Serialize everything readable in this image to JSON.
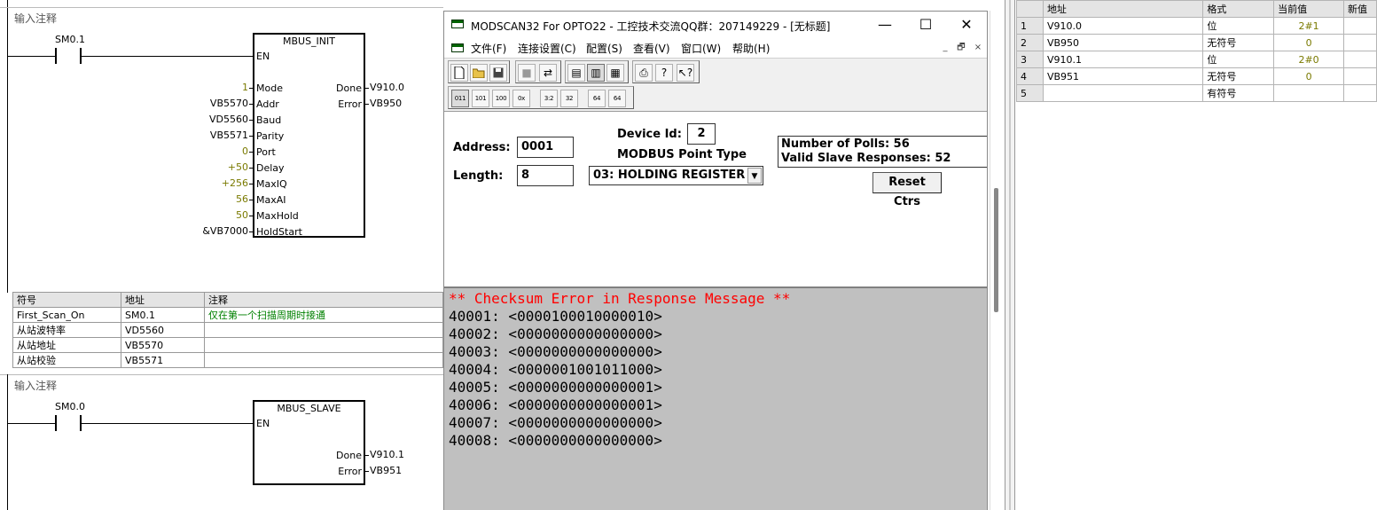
{
  "ladder": {
    "network1": {
      "title": "输入注释",
      "contact": "SM0.1",
      "box_title": "MBUS_INIT",
      "en": "EN",
      "inputs": [
        {
          "pin": "Mode",
          "value": "1"
        },
        {
          "pin": "Addr",
          "value": "VB5570"
        },
        {
          "pin": "Baud",
          "value": "VD5560"
        },
        {
          "pin": "Parity",
          "value": "VB5571"
        },
        {
          "pin": "Port",
          "value": "0"
        },
        {
          "pin": "Delay",
          "value": "+50"
        },
        {
          "pin": "MaxIQ",
          "value": "+256"
        },
        {
          "pin": "MaxAI",
          "value": "56"
        },
        {
          "pin": "MaxHold",
          "value": "50"
        },
        {
          "pin": "HoldStart",
          "value": "&VB7000"
        }
      ],
      "outputs": [
        {
          "pin": "Done",
          "value": "V910.0"
        },
        {
          "pin": "Error",
          "value": "VB950"
        }
      ]
    },
    "symbol_table": {
      "headers": [
        "符号",
        "地址",
        "注释"
      ],
      "rows": [
        [
          "First_Scan_On",
          "SM0.1",
          "仅在第一个扫描周期时接通"
        ],
        [
          "从站波特率",
          "VD5560",
          ""
        ],
        [
          "从站地址",
          "VB5570",
          ""
        ],
        [
          "从站校验",
          "VB5571",
          ""
        ]
      ]
    },
    "network2": {
      "title": "输入注释",
      "contact": "SM0.0",
      "box_title": "MBUS_SLAVE",
      "en": "EN",
      "outputs": [
        {
          "pin": "Done",
          "value": "V910.1"
        },
        {
          "pin": "Error",
          "value": "VB951"
        }
      ]
    }
  },
  "modscan": {
    "title": "MODSCAN32 For OPTO22 - 工控技术交流QQ群：207149229 - [无标题]",
    "window_buttons": {
      "minimize": "—",
      "maximize": "☐",
      "close": "✕"
    },
    "menu": [
      "文件(F)",
      "连接设置(C)",
      "配置(S)",
      "查看(V)",
      "窗口(W)",
      "帮助(H)"
    ],
    "mdi_buttons": [
      "_",
      "🗗",
      "×"
    ],
    "toolbar2": [
      "011",
      "101",
      "100",
      "0x",
      "3:2",
      "32",
      "64",
      "64"
    ],
    "form": {
      "address_label": "Address:",
      "address_value": "0001",
      "length_label": "Length:",
      "length_value": "8",
      "device_id_label": "Device Id:",
      "device_id_value": "2",
      "point_type_label": "MODBUS Point Type",
      "point_type_value": "03: HOLDING REGISTER",
      "polls": "Number of Polls: 56",
      "responses": "Valid Slave Responses: 52",
      "reset_label": "Reset Ctrs"
    },
    "data": {
      "error": "** Checksum Error in Response Message **",
      "registers": [
        "40001: <0000100010000010>",
        "40002: <0000000000000000>",
        "40003: <0000000000000000>",
        "40004: <0000001001011000>",
        "40005: <0000000000000001>",
        "40006: <0000000000000001>",
        "40007: <0000000000000000>",
        "40008: <0000000000000000>"
      ]
    }
  },
  "status_chart": {
    "headers": [
      "",
      "地址",
      "格式",
      "当前值",
      "新值"
    ],
    "rows": [
      {
        "n": "1",
        "addr": "V910.0",
        "fmt": "位",
        "val": "2#1",
        "new": ""
      },
      {
        "n": "2",
        "addr": "VB950",
        "fmt": "无符号",
        "val": "0",
        "new": ""
      },
      {
        "n": "3",
        "addr": "V910.1",
        "fmt": "位",
        "val": "2#0",
        "new": ""
      },
      {
        "n": "4",
        "addr": "VB951",
        "fmt": "无符号",
        "val": "0",
        "new": ""
      },
      {
        "n": "5",
        "addr": "",
        "fmt": "有符号",
        "val": "",
        "new": ""
      }
    ]
  }
}
